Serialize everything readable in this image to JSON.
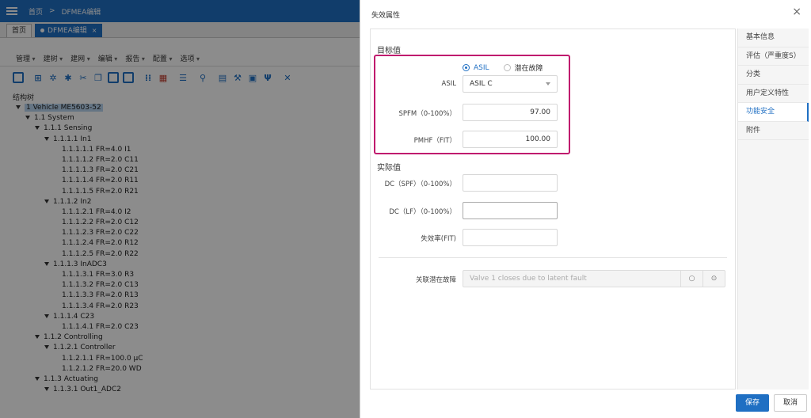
{
  "app": {
    "breadcrumb_home": "首页",
    "breadcrumb_sep": ">",
    "breadcrumb_current": "DFMEA编辑",
    "tabs": [
      {
        "label": "首页"
      },
      {
        "label": "DFMEA编辑"
      }
    ],
    "tab_close": "×",
    "menus": [
      "管理",
      "建树",
      "建网",
      "编辑",
      "报告",
      "配置",
      "选项"
    ],
    "tree_header": "结构树",
    "tree": [
      {
        "label": "1 Vehicle ME5603-52",
        "expanded": true,
        "selected": true
      },
      {
        "label": "1.1 System",
        "expanded": true
      },
      {
        "label": "1.1.1 Sensing",
        "expanded": true
      },
      {
        "label": "1.1.1.1 In1",
        "expanded": true
      },
      {
        "label": "1.1.1.1.1 FR=4.0 I1"
      },
      {
        "label": "1.1.1.1.2 FR=2.0 C11"
      },
      {
        "label": "1.1.1.1.3 FR=2.0 C21"
      },
      {
        "label": "1.1.1.1.4 FR=2.0 R11"
      },
      {
        "label": "1.1.1.1.5 FR=2.0 R21"
      },
      {
        "label": "1.1.1.2 In2",
        "expanded": true
      },
      {
        "label": "1.1.1.2.1 FR=4.0 I2"
      },
      {
        "label": "1.1.1.2.2 FR=2.0 C12"
      },
      {
        "label": "1.1.1.2.3 FR=2.0 C22"
      },
      {
        "label": "1.1.1.2.4 FR=2.0 R12"
      },
      {
        "label": "1.1.1.2.5 FR=2.0 R22"
      },
      {
        "label": "1.1.1.3 InADC3",
        "expanded": true
      },
      {
        "label": "1.1.1.3.1 FR=3.0 R3"
      },
      {
        "label": "1.1.1.3.2 FR=2.0 C13"
      },
      {
        "label": "1.1.1.3.3 FR=2.0 R13"
      },
      {
        "label": "1.1.1.3.4 FR=2.0 R23"
      },
      {
        "label": "1.1.1.4 C23",
        "expanded": true
      },
      {
        "label": "1.1.1.4.1 FR=2.0 C23"
      },
      {
        "label": "1.1.2 Controlling",
        "expanded": true
      },
      {
        "label": "1.1.2.1 Controller",
        "expanded": true
      },
      {
        "label": "1.1.2.1.1 FR=100.0 μC"
      },
      {
        "label": "1.1.2.1.2 FR=20.0 WD"
      },
      {
        "label": "1.1.3 Actuating",
        "expanded": true
      },
      {
        "label": "1.1.3.1 Out1_ADC2",
        "expanded": true
      }
    ]
  },
  "dialog": {
    "title": "失效属性",
    "close": "×",
    "side_nav": [
      {
        "label": "基本信息"
      },
      {
        "label": "评估（严重度S）"
      },
      {
        "label": "分类"
      },
      {
        "label": "用户定义特性"
      },
      {
        "label": "功能安全",
        "active": true
      },
      {
        "label": "附件"
      }
    ],
    "target": {
      "title": "目标值",
      "radio_asil": "ASIL",
      "radio_latent": "潜在故障",
      "asil_label": "ASIL",
      "asil_value": "ASIL C",
      "spfm_label": "SPFM（0-100%）",
      "spfm_value": "97.00",
      "pmhf_label": "PMHF（FIT）",
      "pmhf_value": "100.00"
    },
    "actual": {
      "title": "实际值",
      "dc_spf_label": "DC（SPF）（0-100%）",
      "dc_spf_value": "",
      "dc_lf_label": "DC（LF）（0-100%）",
      "dc_lf_value": "",
      "failure_rate_label": "失效率(FIT)",
      "failure_rate_value": ""
    },
    "assoc_label": "关联潜在故障",
    "assoc_placeholder": "Valve 1 closes due to latent fault",
    "save": "保存",
    "cancel": "取消"
  },
  "colors": {
    "accent": "#1f6fc3",
    "highlight_box": "#c01a6e"
  }
}
